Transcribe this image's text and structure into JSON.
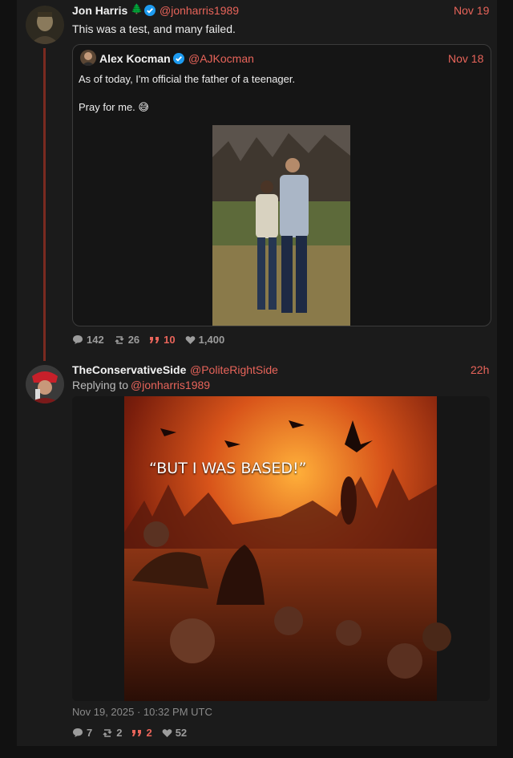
{
  "post1": {
    "author_name": "Jon Harris",
    "author_emoji": "🌲",
    "handle": "@jonharris1989",
    "date": "Nov 19",
    "text": "This was a test, and many failed.",
    "quote": {
      "author_name": "Alex Kocman",
      "handle": "@AJKocman",
      "date": "Nov 18",
      "line1": "As of today, I'm official the father of a teenager.",
      "line2": "Pray for me. 😅"
    },
    "stats": {
      "replies": "142",
      "reposts": "26",
      "quotes": "10",
      "likes": "1,400"
    }
  },
  "post2": {
    "author_name": "TheConservativeSide",
    "handle": "@PoliteRightSide",
    "date": "22h",
    "replying_prefix": "Replying to",
    "replying_handle": "@jonharris1989",
    "image_caption": "“BUT I WAS BASED!”",
    "timestamp": "Nov 19, 2025 · 10:32 PM UTC",
    "stats": {
      "replies": "7",
      "reposts": "2",
      "quotes": "2",
      "likes": "52"
    }
  },
  "colors": {
    "accent": "#e8645a",
    "verified": "#1d9bf0",
    "background": "#1b1b1b",
    "thread_line": "#7a2a20"
  },
  "icons": [
    "verified-badge-icon",
    "comment-icon",
    "repost-icon",
    "quote-icon",
    "heart-icon"
  ]
}
